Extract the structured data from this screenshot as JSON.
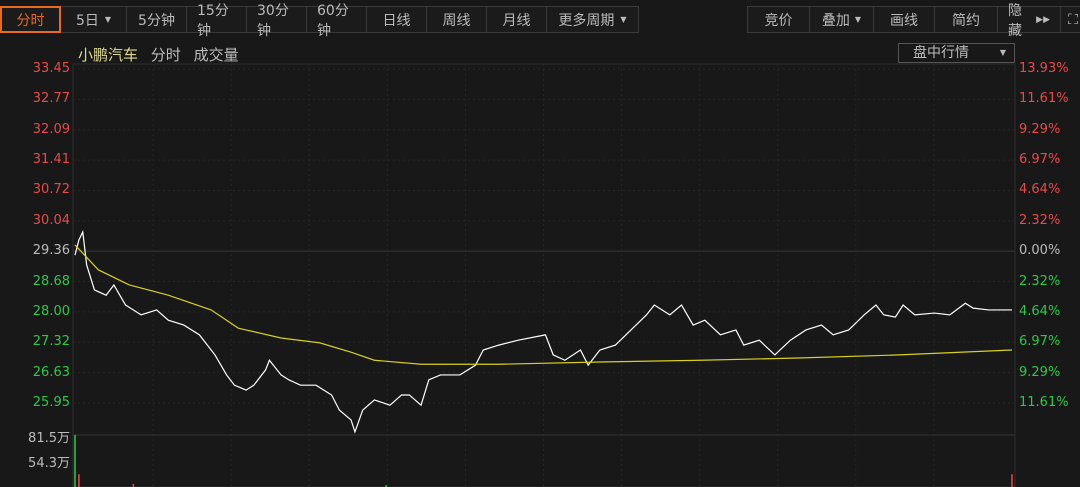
{
  "toolbar": {
    "tabs": [
      "分时",
      "5日",
      "5分钟",
      "15分钟",
      "30分钟",
      "60分钟",
      "日线",
      "周线",
      "月线",
      "更多周期"
    ],
    "right": [
      "竞价",
      "叠加",
      "画线",
      "简约",
      "隐藏"
    ]
  },
  "header": {
    "stock": "小鹏汽车",
    "mode": "分时",
    "volume": "成交量",
    "dropdown": "盘中行情"
  },
  "chart_data": {
    "type": "line",
    "title": "小鹏汽车 分时",
    "y_left_ticks": [
      "33.45",
      "32.77",
      "32.09",
      "31.41",
      "30.72",
      "30.04",
      "29.36",
      "28.68",
      "28.00",
      "27.32",
      "26.63",
      "25.95"
    ],
    "y_right_ticks": [
      "13.93%",
      "11.61%",
      "9.29%",
      "6.97%",
      "4.64%",
      "2.32%",
      "0.00%",
      "2.32%",
      "4.64%",
      "6.97%",
      "9.29%",
      "11.61%"
    ],
    "ylim": [
      25.95,
      33.45
    ],
    "prev_close": 29.36,
    "xlim": [
      0,
      241
    ],
    "volume_ticks": [
      "81.5万",
      "54.3万"
    ],
    "colors": {
      "up": "#e84a4a",
      "down": "#2ec84a",
      "price": "#ffffff",
      "avg": "#d8d020",
      "neutral": "#bbbbbb"
    },
    "series": [
      {
        "name": "price",
        "points": [
          [
            0,
            29.27
          ],
          [
            1,
            29.61
          ],
          [
            2,
            29.79
          ],
          [
            3,
            29.05
          ],
          [
            5,
            28.49
          ],
          [
            8,
            28.37
          ],
          [
            10,
            28.6
          ],
          [
            13,
            28.15
          ],
          [
            17,
            27.93
          ],
          [
            21,
            28.04
          ],
          [
            24,
            27.81
          ],
          [
            28,
            27.7
          ],
          [
            32,
            27.48
          ],
          [
            36,
            27.03
          ],
          [
            39,
            26.58
          ],
          [
            41,
            26.35
          ],
          [
            44,
            26.24
          ],
          [
            46,
            26.35
          ],
          [
            49,
            26.69
          ],
          [
            50,
            26.91
          ],
          [
            53,
            26.58
          ],
          [
            55,
            26.47
          ],
          [
            58,
            26.35
          ],
          [
            62,
            26.35
          ],
          [
            66,
            26.13
          ],
          [
            68,
            25.79
          ],
          [
            71,
            25.57
          ],
          [
            72,
            25.3
          ],
          [
            74,
            25.79
          ],
          [
            77,
            26.02
          ],
          [
            81,
            25.9
          ],
          [
            84,
            26.13
          ],
          [
            86,
            26.13
          ],
          [
            89,
            25.9
          ],
          [
            91,
            26.47
          ],
          [
            94,
            26.58
          ],
          [
            99,
            26.58
          ],
          [
            103,
            26.8
          ],
          [
            105,
            27.14
          ],
          [
            109,
            27.25
          ],
          [
            114,
            27.36
          ],
          [
            121,
            27.48
          ],
          [
            123,
            27.03
          ],
          [
            126,
            26.91
          ],
          [
            130,
            27.14
          ],
          [
            132,
            26.8
          ],
          [
            135,
            27.14
          ],
          [
            139,
            27.25
          ],
          [
            143,
            27.59
          ],
          [
            147,
            27.93
          ],
          [
            149,
            28.15
          ],
          [
            153,
            27.93
          ],
          [
            156,
            28.15
          ],
          [
            159,
            27.7
          ],
          [
            162,
            27.81
          ],
          [
            166,
            27.48
          ],
          [
            170,
            27.59
          ],
          [
            172,
            27.25
          ],
          [
            176,
            27.36
          ],
          [
            180,
            27.03
          ],
          [
            184,
            27.36
          ],
          [
            188,
            27.59
          ],
          [
            192,
            27.7
          ],
          [
            195,
            27.48
          ],
          [
            199,
            27.59
          ],
          [
            203,
            27.93
          ],
          [
            206,
            28.15
          ],
          [
            208,
            27.93
          ],
          [
            211,
            27.88
          ],
          [
            213,
            28.15
          ],
          [
            216,
            27.93
          ],
          [
            221,
            27.97
          ],
          [
            225,
            27.93
          ],
          [
            229,
            28.19
          ],
          [
            231,
            28.08
          ],
          [
            235,
            28.04
          ],
          [
            241,
            28.04
          ]
        ]
      },
      {
        "name": "average",
        "points": [
          [
            0,
            29.5
          ],
          [
            6,
            28.94
          ],
          [
            14,
            28.6
          ],
          [
            24,
            28.37
          ],
          [
            35,
            28.04
          ],
          [
            42,
            27.63
          ],
          [
            53,
            27.41
          ],
          [
            63,
            27.3
          ],
          [
            71,
            27.09
          ],
          [
            77,
            26.91
          ],
          [
            89,
            26.82
          ],
          [
            109,
            26.82
          ],
          [
            135,
            26.87
          ],
          [
            161,
            26.91
          ],
          [
            186,
            26.96
          ],
          [
            212,
            27.03
          ],
          [
            241,
            27.14
          ]
        ]
      }
    ],
    "volume_bars": [
      [
        0,
        81.5,
        "down"
      ],
      [
        1,
        20,
        "up"
      ],
      [
        15,
        5,
        "up"
      ],
      [
        80,
        3,
        "down"
      ],
      [
        241,
        20,
        "up"
      ]
    ]
  }
}
